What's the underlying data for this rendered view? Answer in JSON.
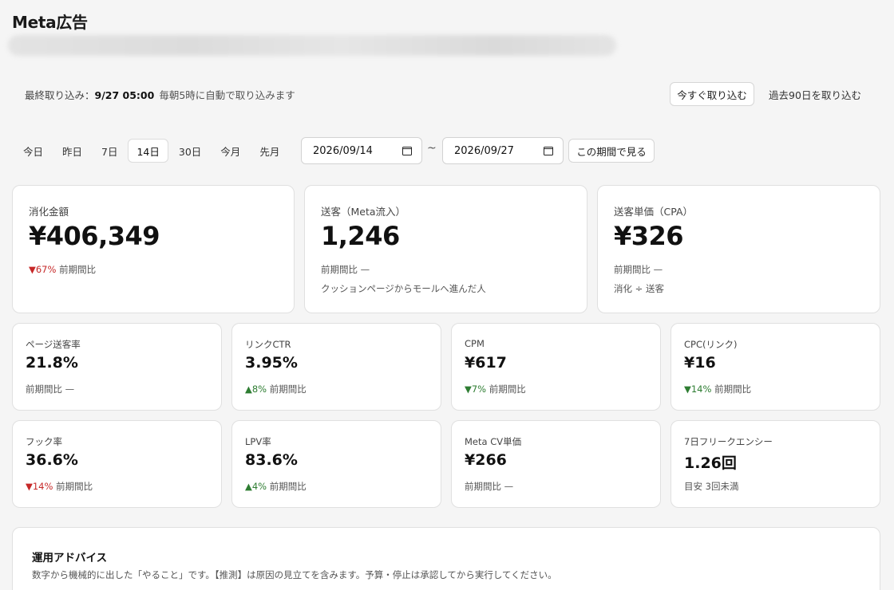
{
  "page": {
    "title": "Meta広告"
  },
  "import": {
    "last_label": "最終取り込み：",
    "last_value": "9/27 05:00",
    "note": "毎朝5時に自動で取り込みます",
    "import_now_label": "今すぐ取り込む",
    "import_90_label": "過去90日を取り込む"
  },
  "range": {
    "tabs": [
      "今日",
      "昨日",
      "7日",
      "14日",
      "30日",
      "今月",
      "先月"
    ],
    "active": "14日",
    "start_date": "2026/09/14",
    "end_date": "2026/09/27",
    "separator": "~",
    "view_label": "この期間で見る"
  },
  "kpi_big": [
    {
      "label": "消化金額",
      "value": "¥406,349",
      "delta_arrow": "▼",
      "delta_pct": "67%",
      "delta_dir": "down",
      "delta_suffix": "前期間比",
      "sub": ""
    },
    {
      "label": "送客（Meta流入）",
      "value": "1,246",
      "delta_arrow": "",
      "delta_pct": "",
      "delta_dir": "none",
      "delta_suffix": "前期間比 —",
      "sub": "クッションページからモールへ進んだ人"
    },
    {
      "label": "送客単価（CPA）",
      "value": "¥326",
      "delta_arrow": "",
      "delta_pct": "",
      "delta_dir": "none",
      "delta_suffix": "前期間比 —",
      "sub": "消化 ÷ 送客"
    }
  ],
  "kpi_small": [
    {
      "label": "ページ送客率",
      "value": "21.8%",
      "delta_arrow": "",
      "delta_pct": "",
      "delta_dir": "none",
      "delta_suffix": "前期間比 —"
    },
    {
      "label": "リンクCTR",
      "value": "3.95%",
      "delta_arrow": "▲",
      "delta_pct": "8%",
      "delta_dir": "up",
      "delta_suffix": "前期間比"
    },
    {
      "label": "CPM",
      "value": "¥617",
      "delta_arrow": "▼",
      "delta_pct": "7%",
      "delta_dir": "up",
      "delta_suffix": "前期間比"
    },
    {
      "label": "CPC(リンク)",
      "value": "¥16",
      "delta_arrow": "▼",
      "delta_pct": "14%",
      "delta_dir": "up",
      "delta_suffix": "前期間比"
    },
    {
      "label": "フック率",
      "value": "36.6%",
      "delta_arrow": "▼",
      "delta_pct": "14%",
      "delta_dir": "down",
      "delta_suffix": "前期間比"
    },
    {
      "label": "LPV率",
      "value": "83.6%",
      "delta_arrow": "▲",
      "delta_pct": "4%",
      "delta_dir": "up",
      "delta_suffix": "前期間比"
    },
    {
      "label": "Meta CV単価",
      "value": "¥266",
      "delta_arrow": "",
      "delta_pct": "",
      "delta_dir": "none",
      "delta_suffix": "前期間比 —"
    },
    {
      "label": "7日フリークエンシー",
      "value": "1.26回",
      "delta_arrow": "",
      "delta_pct": "",
      "delta_dir": "none",
      "delta_suffix": "目安 3回未満"
    }
  ],
  "advice": {
    "title": "運用アドバイス",
    "desc": "数字から機械的に出した「やること」です。【推測】は原因の見立てを含みます。予算・停止は承認してから実行してください。"
  },
  "colors": {
    "down": "#c62828",
    "up": "#2e7d32"
  }
}
